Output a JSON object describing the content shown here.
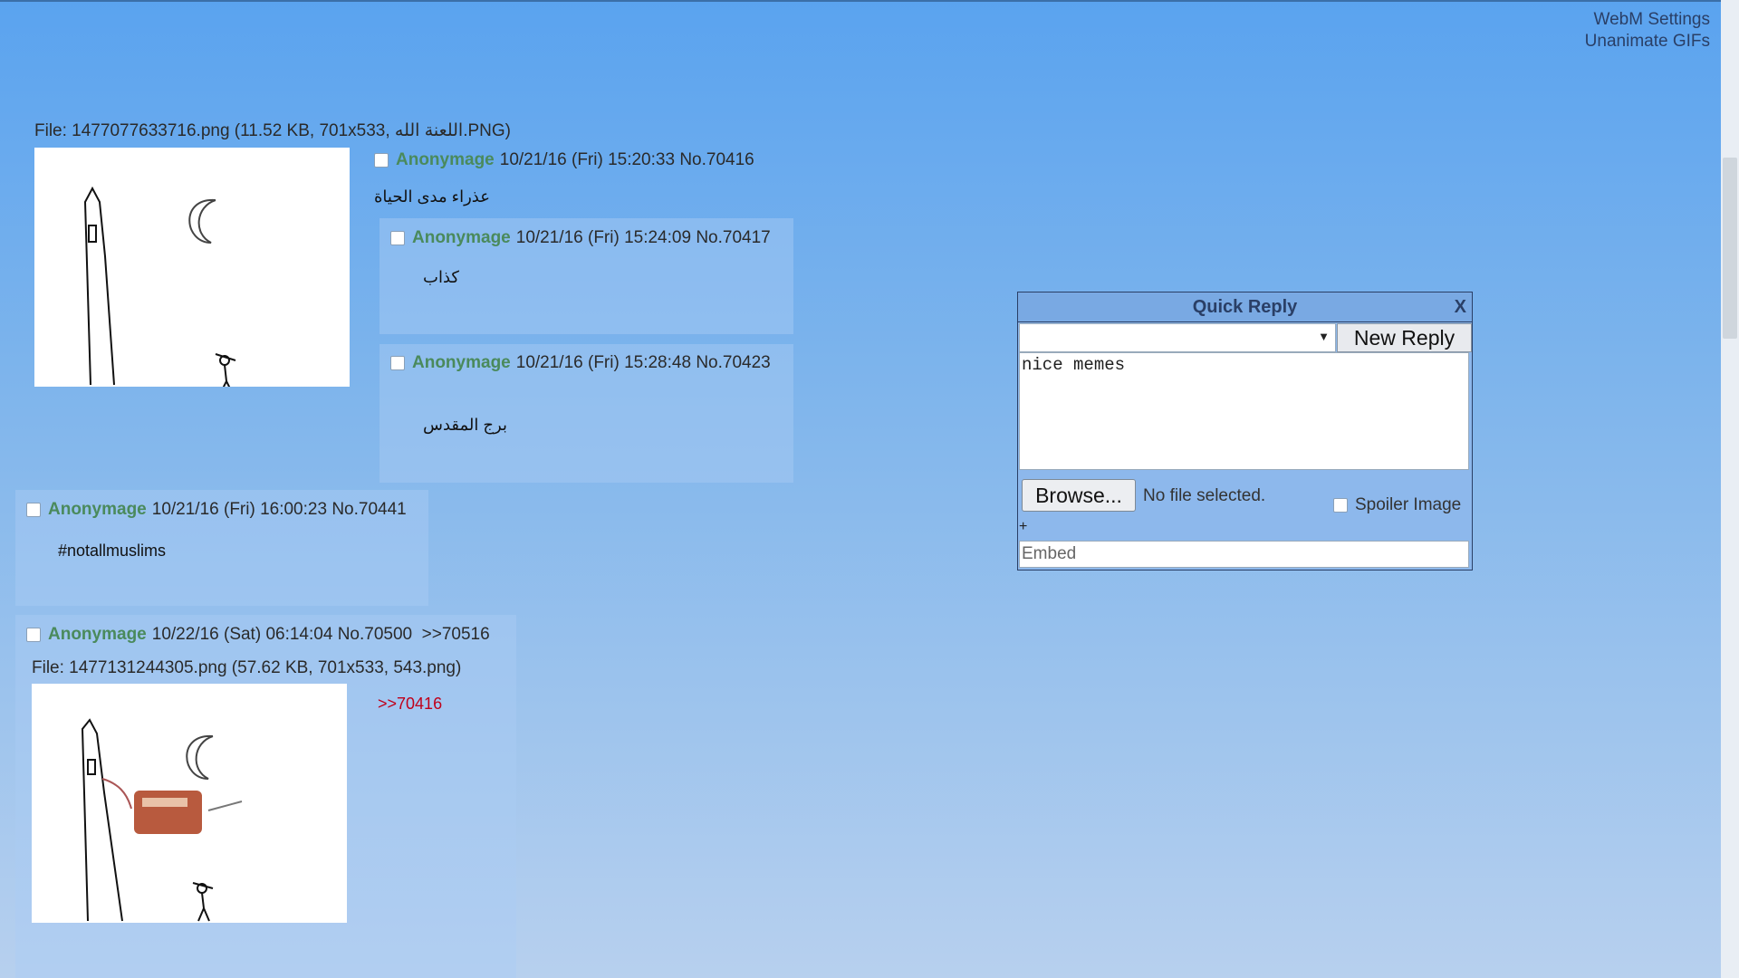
{
  "top_links": {
    "webm_settings": "WebM Settings",
    "unanimate_gifs": "Unanimate GIFs"
  },
  "op": {
    "file_info": "File: 1477077633716.png (11.52 KB, 701x533, اللعنة الله.PNG)",
    "name": "Anonymage",
    "datetime": "10/21/16 (Fri) 15:20:33",
    "number": "No.70416",
    "message": "عذراء مدى الحياة"
  },
  "posts": [
    {
      "name": "Anonymage",
      "datetime": "10/21/16 (Fri) 15:24:09",
      "number": "No.70417",
      "message": "كذاب"
    },
    {
      "name": "Anonymage",
      "datetime": "10/21/16 (Fri) 15:28:48",
      "number": "No.70423",
      "message": "برج المقدس"
    },
    {
      "name": "Anonymage",
      "datetime": "10/21/16 (Fri) 16:00:23",
      "number": "No.70441",
      "message": "#notallmuslims"
    },
    {
      "name": "Anonymage",
      "datetime": "10/22/16 (Sat) 06:14:04",
      "number": "No.70500",
      "backlink": ">>70516",
      "file_info": "File: 1477131244305.png (57.62 KB, 701x533, 543.png)",
      "quote": ">>70416"
    }
  ],
  "quick_reply": {
    "title": "Quick Reply",
    "close": "X",
    "new_reply": "New Reply",
    "message_value": "nice memes",
    "browse": "Browse...",
    "no_file": "No file selected.",
    "spoiler": "Spoiler Image",
    "plus": "+",
    "embed_placeholder": "Embed"
  }
}
